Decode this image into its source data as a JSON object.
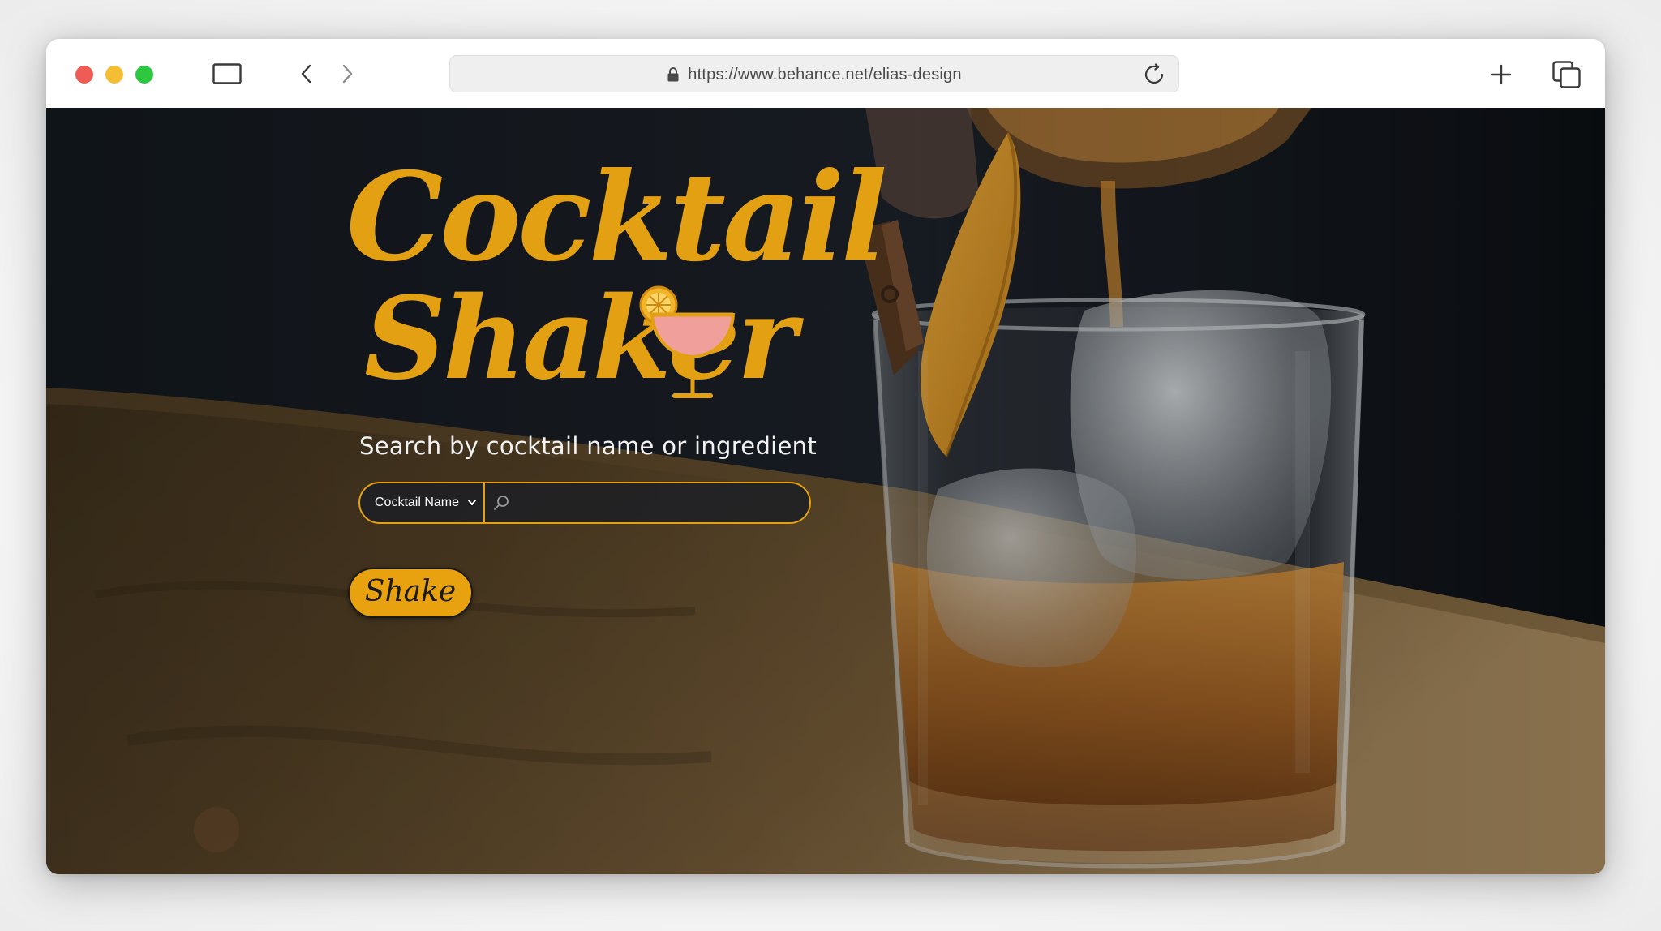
{
  "browser": {
    "url": "https://www.behance.net/elias-design",
    "colors": {
      "close": "#ee5c55",
      "minimize": "#f4bd34",
      "maximize": "#2dc840"
    },
    "icons": {
      "sidebar": "sidebar-icon",
      "back": "chevron-left-icon",
      "forward": "chevron-right-icon",
      "lock": "lock-icon",
      "reload": "reload-icon",
      "new_tab": "plus-icon",
      "tabs": "tabs-icon"
    }
  },
  "hero": {
    "logo_line1": "Cocktail",
    "logo_line2": "Shaker",
    "tagline": "Search by cocktail name or ingredient",
    "search": {
      "mode_selected": "Cocktail Name",
      "value": "",
      "placeholder": ""
    },
    "shake_label": "Shake",
    "colors": {
      "accent": "#e3a013",
      "button": "#e8a20f",
      "cocktail": "#f09f9a"
    }
  }
}
